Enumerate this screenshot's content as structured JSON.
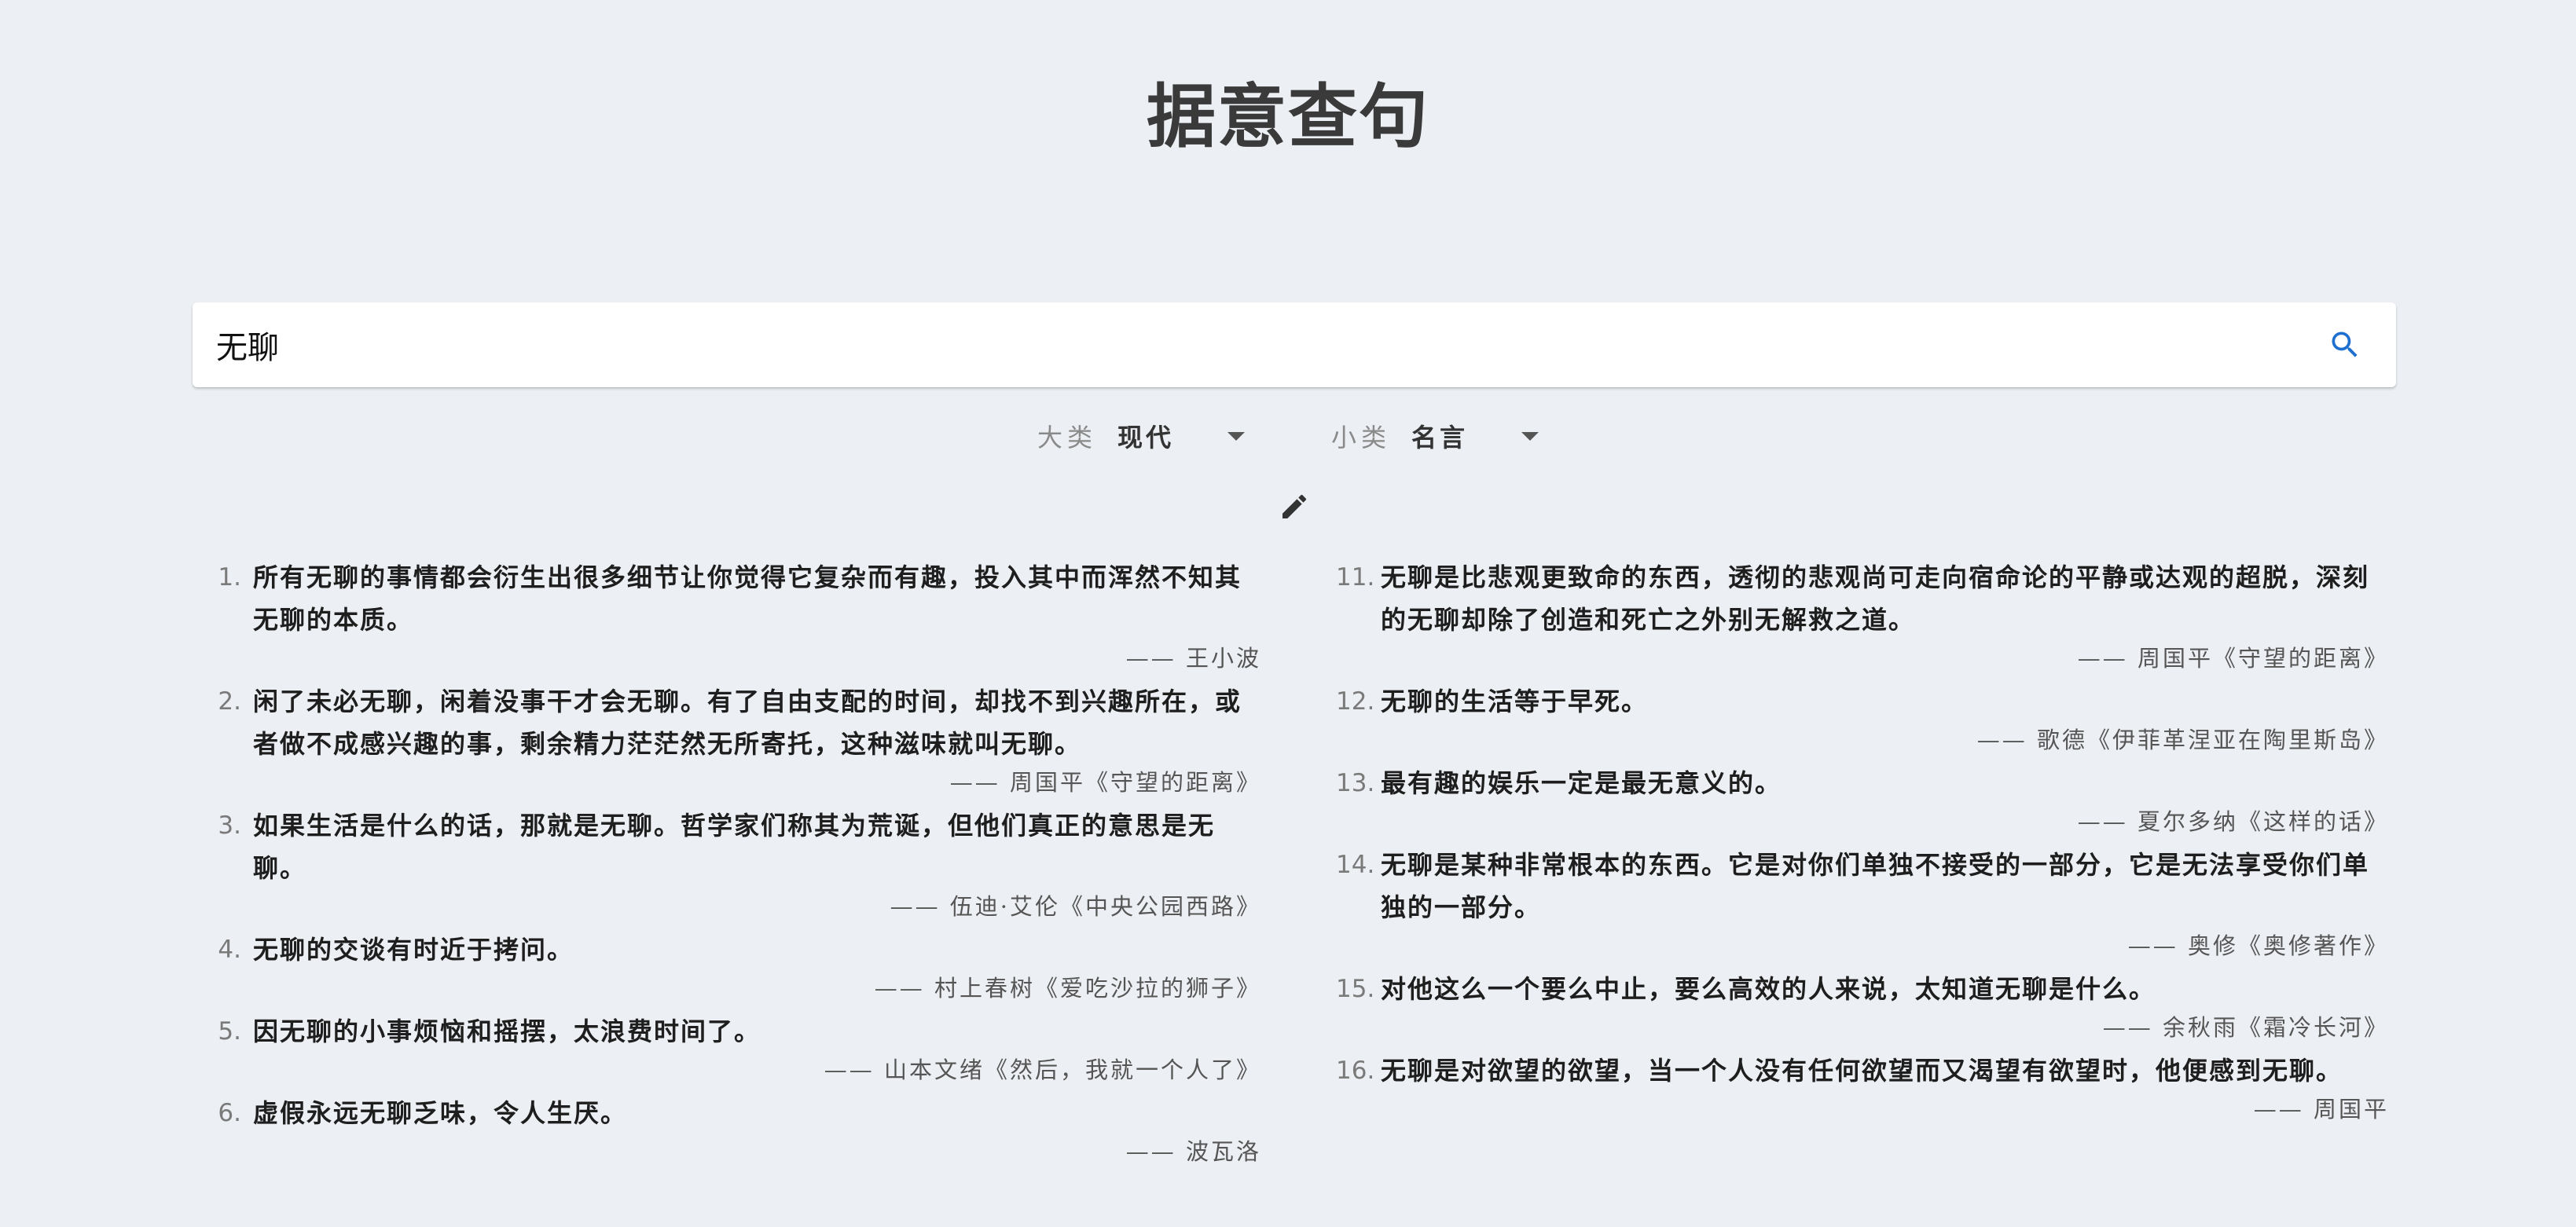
{
  "title": "据意查句",
  "search": {
    "value": "无聊",
    "icon": "search-icon"
  },
  "filters": {
    "major": {
      "label": "大类",
      "value": "现代"
    },
    "minor": {
      "label": "小类",
      "value": "名言"
    }
  },
  "colors": {
    "background": "#eceff3",
    "search_icon": "#1e6fd0"
  },
  "results_left": [
    {
      "num": "1.",
      "text": "所有无聊的事情都会衍生出很多细节让你觉得它复杂而有趣，投入其中而浑然不知其无聊的本质。",
      "source": "—— 王小波"
    },
    {
      "num": "2.",
      "text": "闲了未必无聊，闲着没事干才会无聊。有了自由支配的时间，却找不到兴趣所在，或者做不成感兴趣的事，剩余精力茫茫然无所寄托，这种滋味就叫无聊。",
      "source": "—— 周国平《守望的距离》"
    },
    {
      "num": "3.",
      "text": "如果生活是什么的话，那就是无聊。哲学家们称其为荒诞，但他们真正的意思是无聊。",
      "source": "—— 伍迪·艾伦《中央公园西路》"
    },
    {
      "num": "4.",
      "text": "无聊的交谈有时近于拷问。",
      "source": "—— 村上春树《爱吃沙拉的狮子》"
    },
    {
      "num": "5.",
      "text": "因无聊的小事烦恼和摇摆，太浪费时间了。",
      "source": "—— 山本文绪《然后，我就一个人了》"
    },
    {
      "num": "6.",
      "text": "虚假永远无聊乏味，令人生厌。",
      "source": "—— 波瓦洛"
    }
  ],
  "results_right": [
    {
      "num": "11.",
      "text": "无聊是比悲观更致命的东西，透彻的悲观尚可走向宿命论的平静或达观的超脱，深刻的无聊却除了创造和死亡之外别无解救之道。",
      "source": "—— 周国平《守望的距离》"
    },
    {
      "num": "12.",
      "text": "无聊的生活等于早死。",
      "source": "—— 歌德《伊菲革涅亚在陶里斯岛》"
    },
    {
      "num": "13.",
      "text": "最有趣的娱乐一定是最无意义的。",
      "source": "—— 夏尔多纳《这样的话》"
    },
    {
      "num": "14.",
      "text": "无聊是某种非常根本的东西。它是对你们单独不接受的一部分，它是无法享受你们单独的一部分。",
      "source": "—— 奥修《奥修著作》"
    },
    {
      "num": "15.",
      "text": "对他这么一个要么中止，要么高效的人来说，太知道无聊是什么。",
      "source": "—— 余秋雨《霜冷长河》"
    },
    {
      "num": "16.",
      "text": "无聊是对欲望的欲望，当一个人没有任何欲望而又渴望有欲望时，他便感到无聊。",
      "source": "—— 周国平"
    }
  ]
}
